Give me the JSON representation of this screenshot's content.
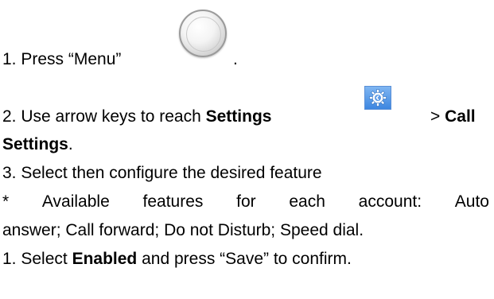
{
  "step1": {
    "text": "1. Press “Menu”",
    "trailing": ".",
    "icon": "menu-round-key-icon"
  },
  "step2": {
    "text": "2. Use arrow keys to reach",
    "settings": "Settings",
    "icon": "settings-gear-icon",
    "separator": ">",
    "call": "Call",
    "call_settings": "Settings",
    "trailing": "."
  },
  "step3": {
    "text": "3. Select then configure the desired feature"
  },
  "note": {
    "words": [
      "*",
      "Available",
      "features",
      "for",
      "each",
      "account:",
      "Auto"
    ],
    "line2": "answer; Call forward; Do not Disturb; Speed dial."
  },
  "step4": {
    "prefix": "1. Select",
    "enabled": "Enabled",
    "suffix": "and press “Save” to confirm."
  }
}
